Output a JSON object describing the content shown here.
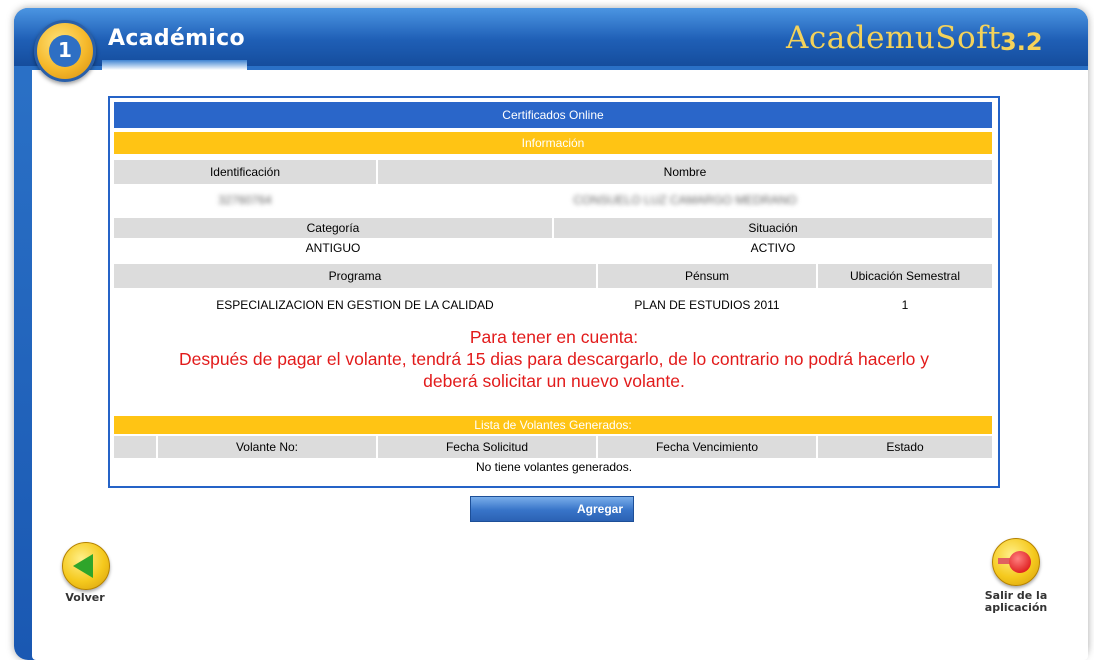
{
  "header": {
    "app_title": "Académico",
    "brand_name": "AcademuSoft",
    "brand_version": "3.2",
    "app_icon_digit": "1"
  },
  "panel": {
    "title": "Certificados Online",
    "info_section": "Información",
    "fields": {
      "identificacion_label": "Identificación",
      "nombre_label": "Nombre",
      "identificacion_value": "32760764",
      "nombre_value": "CONSUELO LUZ CAMARGO MEDRANO",
      "categoria_label": "Categoría",
      "situacion_label": "Situación",
      "categoria_value": "ANTIGUO",
      "situacion_value": "ACTIVO",
      "programa_label": "Programa",
      "pensum_label": "Pénsum",
      "ubicacion_label": "Ubicación Semestral",
      "programa_value": "ESPECIALIZACION EN GESTION DE LA CALIDAD",
      "pensum_value": "PLAN DE ESTUDIOS 2011",
      "ubicacion_value": "1"
    },
    "note": {
      "line1": "Para tener en cuenta:",
      "line2": "Después de pagar el volante, tendrá 15 dias para descargarlo, de lo contrario no podrá hacerlo y",
      "line3": "deberá solicitar un nuevo volante."
    },
    "list_section": "Lista de Volantes Generados:",
    "columns": [
      "Volante No:",
      "Fecha Solicitud",
      "Fecha Vencimiento",
      "Estado"
    ],
    "empty_message": "No tiene volantes generados."
  },
  "actions": {
    "add_label": "Agregar",
    "back_label": "Volver",
    "exit_label_1": "Salir de la",
    "exit_label_2": "aplicación"
  },
  "colors": {
    "accent_blue": "#2a66c9",
    "section_yellow": "#ffc414",
    "note_red": "#e21b1b"
  }
}
